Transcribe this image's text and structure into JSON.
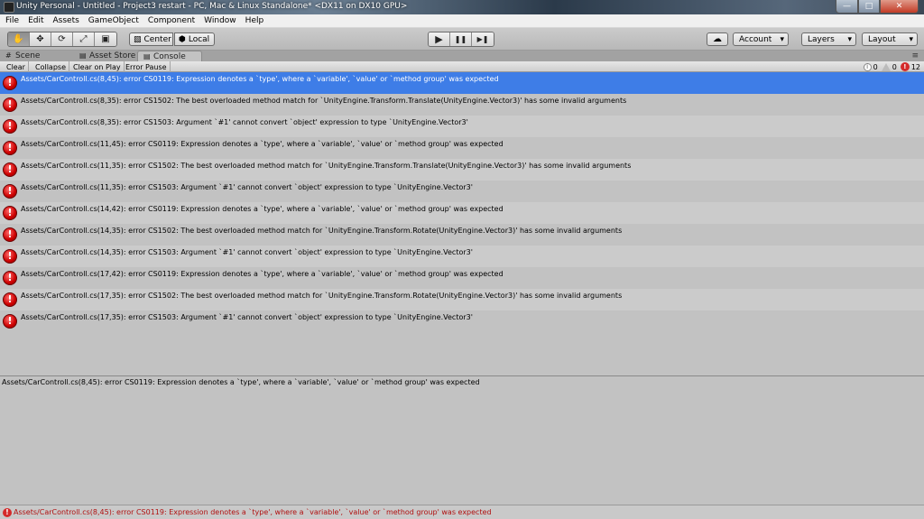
{
  "window": {
    "title": "Unity Personal - Untitled - Project3 restart - PC, Mac & Linux Standalone* <DX11 on DX10 GPU>",
    "min_glyph": "—",
    "max_glyph": "□",
    "close_glyph": "✕"
  },
  "menu": [
    "File",
    "Edit",
    "Assets",
    "GameObject",
    "Component",
    "Window",
    "Help"
  ],
  "toolbar": {
    "tools": [
      {
        "name": "hand-tool",
        "glyph": "✋"
      },
      {
        "name": "move-tool",
        "glyph": "✥"
      },
      {
        "name": "rotate-tool",
        "glyph": "⟳"
      },
      {
        "name": "scale-tool",
        "glyph": "⤢"
      },
      {
        "name": "rect-tool",
        "glyph": "▣"
      }
    ],
    "pivot_label": "Center",
    "pivot_glyph": "▧",
    "space_label": "Local",
    "space_glyph": "⬢",
    "play_glyph": "▶",
    "pause_glyph": "❚❚",
    "step_glyph": "▶❚",
    "cloud_glyph": "☁",
    "account_label": "Account",
    "layers_label": "Layers",
    "layout_label": "Layout",
    "dropdown_glyph": "▾"
  },
  "tabs": [
    {
      "label": "Scene",
      "glyph": "#"
    },
    {
      "label": "Asset Store",
      "glyph": "▤"
    },
    {
      "label": "Console",
      "glyph": "▤"
    }
  ],
  "tab_menu_glyph": "≡",
  "console_toolbar": {
    "clear": "Clear",
    "collapse": "Collapse",
    "clear_on_play": "Clear on Play",
    "error_pause": "Error Pause",
    "info_count": "0",
    "warning_count": "0",
    "error_count": "12"
  },
  "messages": [
    "Assets/CarControll.cs(8,45): error CS0119: Expression denotes a `type', where a `variable', `value' or `method group' was expected",
    "Assets/CarControll.cs(8,35): error CS1502: The best overloaded method match for `UnityEngine.Transform.Translate(UnityEngine.Vector3)' has some invalid arguments",
    "Assets/CarControll.cs(8,35): error CS1503: Argument `#1' cannot convert `object' expression to type `UnityEngine.Vector3'",
    "Assets/CarControll.cs(11,45): error CS0119: Expression denotes a `type', where a `variable', `value' or `method group' was expected",
    "Assets/CarControll.cs(11,35): error CS1502: The best overloaded method match for `UnityEngine.Transform.Translate(UnityEngine.Vector3)' has some invalid arguments",
    "Assets/CarControll.cs(11,35): error CS1503: Argument `#1' cannot convert `object' expression to type `UnityEngine.Vector3'",
    "Assets/CarControll.cs(14,42): error CS0119: Expression denotes a `type', where a `variable', `value' or `method group' was expected",
    "Assets/CarControll.cs(14,35): error CS1502: The best overloaded method match for `UnityEngine.Transform.Rotate(UnityEngine.Vector3)' has some invalid arguments",
    "Assets/CarControll.cs(14,35): error CS1503: Argument `#1' cannot convert `object' expression to type `UnityEngine.Vector3'",
    "Assets/CarControll.cs(17,42): error CS0119: Expression denotes a `type', where a `variable', `value' or `method group' was expected",
    "Assets/CarControll.cs(17,35): error CS1502: The best overloaded method match for `UnityEngine.Transform.Rotate(UnityEngine.Vector3)' has some invalid arguments",
    "Assets/CarControll.cs(17,35): error CS1503: Argument `#1' cannot convert `object' expression to type `UnityEngine.Vector3'"
  ],
  "error_glyph": "!",
  "selected_index": 0,
  "detail_text": "Assets/CarControll.cs(8,45): error CS0119: Expression denotes a `type', where a `variable', `value' or `method group' was expected",
  "status_text": "Assets/CarControll.cs(8,45): error CS0119: Expression denotes a `type', where a `variable', `value' or `method group' was expected",
  "colors": {
    "selection": "#3e7de7",
    "error_red": "#d42a2a",
    "status_text": "#b01010"
  }
}
